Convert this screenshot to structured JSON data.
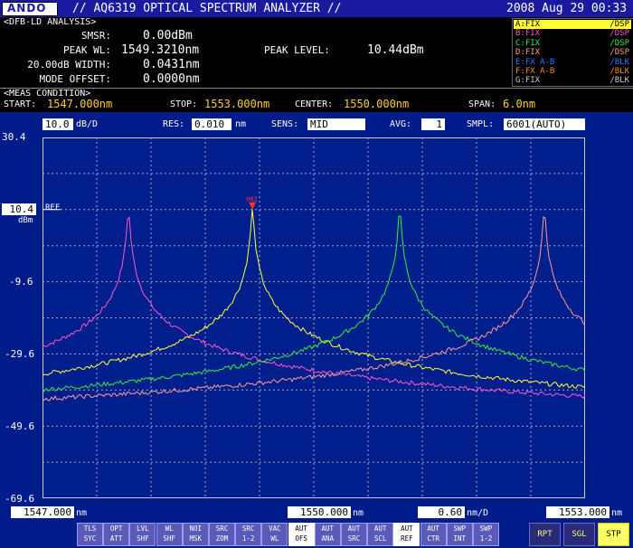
{
  "header": {
    "logo": "ANDO",
    "title": "// AQ6319 OPTICAL SPECTRUM ANALYZER //",
    "datetime": "2008 Aug 29 00:33"
  },
  "analysis": {
    "heading": "<DFB-LD ANALYSIS>",
    "smsr_label": "SMSR:",
    "smsr_value": "0.00dBm",
    "peak_wl_label": "PEAK WL:",
    "peak_wl_value": "1549.3210nm",
    "width_label": "20.00dB WIDTH:",
    "width_value": "0.0431nm",
    "mode_offset_label": "MODE OFFSET:",
    "mode_offset_value": "0.0000nm",
    "peak_level_label": "PEAK LEVEL:",
    "peak_level_value": "10.44dBm"
  },
  "traces": [
    {
      "name": "A:FIX",
      "mode": "/DSP",
      "color": "#ffff33",
      "selected": true
    },
    {
      "name": "B:FIX",
      "mode": "/DSP",
      "color": "#ff55cc",
      "selected": false
    },
    {
      "name": "C:FIX",
      "mode": "/DSP",
      "color": "#33ee33",
      "selected": false
    },
    {
      "name": "D:FIX",
      "mode": "/DSP",
      "color": "#ff9999",
      "selected": false
    },
    {
      "name": "E:FX A-B",
      "mode": "/BLK",
      "color": "#3377ff",
      "selected": false
    },
    {
      "name": "F:FX A-B",
      "mode": "/BLK",
      "color": "#ff8800",
      "selected": false
    },
    {
      "name": "G:FIX",
      "mode": "/BLK",
      "color": "#cccccc",
      "selected": false
    }
  ],
  "meas": {
    "heading": "<MEAS CONDITION>",
    "start_label": "START:",
    "start_value": "1547.000nm",
    "stop_label": "STOP:",
    "stop_value": "1553.000nm",
    "center_label": "CENTER:",
    "center_value": "1550.000nm",
    "span_label": "SPAN:",
    "span_value": "6.0nm"
  },
  "settings": {
    "scale_value": "10.0",
    "scale_unit": "dB/D",
    "res_label": "RES:",
    "res_value": "0.010",
    "res_unit": "nm",
    "sens_label": "SENS:",
    "sens_value": "MID",
    "avg_label": "AVG:",
    "avg_value": "1",
    "smpl_label": "SMPL:",
    "smpl_value": "6001(AUTO)"
  },
  "plot": {
    "ref_value": "10.4",
    "ref_label": "REF",
    "ref_unit": "dBm",
    "marker_label": "002",
    "y_ticks": [
      "30.4",
      "-9.6",
      "-29.6",
      "-49.6",
      "-69.6"
    ],
    "x_start": "1547.000",
    "x_center": "1550.000",
    "x_stop": "1553.000",
    "x_unit": "nm",
    "x_div": "0.60",
    "x_div_unit": "nm/D"
  },
  "chart_data": {
    "type": "line",
    "xlim": [
      1547.0,
      1553.0
    ],
    "ylim": [
      -69.6,
      30.4
    ],
    "y_ref": 10.4,
    "grid": true,
    "series": [
      {
        "name": "B",
        "color": "#ff55cc",
        "peak_x": 1547.95,
        "peak_y": 10.4,
        "floor_left": -47.5,
        "floor_right": -49.8
      },
      {
        "name": "A",
        "color": "#ffff33",
        "peak_x": 1549.321,
        "peak_y": 10.44,
        "floor_left": -49.8,
        "floor_right": -48.5
      },
      {
        "name": "C",
        "color": "#33ee33",
        "peak_x": 1550.95,
        "peak_y": 10.4,
        "floor_left": -49.6,
        "floor_right": -49.6
      },
      {
        "name": "D",
        "color": "#ff9999",
        "peak_x": 1552.55,
        "peak_y": 10.4,
        "floor_left": -49.6,
        "floor_right": -47.6
      }
    ]
  },
  "softkeys": [
    {
      "line1": "TLS",
      "line2": "SYC",
      "style": "normal"
    },
    {
      "line1": "OPT",
      "line2": "ATT",
      "style": "normal"
    },
    {
      "line1": "LVL",
      "line2": "SHF",
      "style": "normal"
    },
    {
      "line1": "WL",
      "line2": "SHF",
      "style": "normal"
    },
    {
      "line1": "NOI",
      "line2": "MSK",
      "style": "normal"
    },
    {
      "line1": "SRC",
      "line2": "ZOM",
      "style": "normal"
    },
    {
      "line1": "SRC",
      "line2": "1-2",
      "style": "normal"
    },
    {
      "line1": "VAC",
      "line2": "WL",
      "style": "normal"
    },
    {
      "line1": "AUT",
      "line2": "OFS",
      "style": "sel"
    },
    {
      "line1": "AUT",
      "line2": "ANA",
      "style": "normal"
    },
    {
      "line1": "AUT",
      "line2": "SRC",
      "style": "normal"
    },
    {
      "line1": "AUT",
      "line2": "SCL",
      "style": "normal"
    },
    {
      "line1": "AUT",
      "line2": "REF",
      "style": "sel"
    },
    {
      "line1": "AUT",
      "line2": "CTR",
      "style": "normal"
    },
    {
      "line1": "SWP",
      "line2": "INT",
      "style": "normal"
    },
    {
      "line1": "SWP",
      "line2": "1-2",
      "style": "normal"
    }
  ],
  "right_keys": [
    "RPT",
    "SGL",
    "STP"
  ]
}
